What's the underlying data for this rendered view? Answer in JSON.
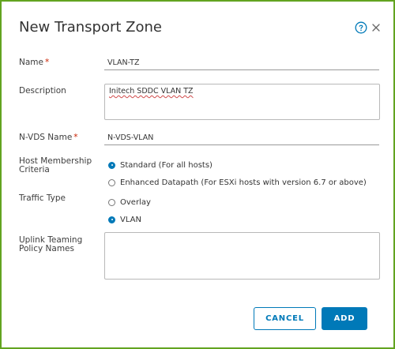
{
  "dialog": {
    "title": "New Transport Zone",
    "icons": {
      "help": "help-circle-icon",
      "close": "close-icon"
    }
  },
  "form": {
    "name": {
      "label": "Name",
      "required_marker": "*",
      "value": "VLAN-TZ"
    },
    "description": {
      "label": "Description",
      "value": "Initech SDDC VLAN TZ"
    },
    "nvds_name": {
      "label": "N-VDS Name",
      "required_marker": "*",
      "value": "N-VDS-VLAN"
    },
    "host_membership": {
      "label_line1": "Host Membership",
      "label_line2": "Criteria",
      "options": [
        {
          "label": "Standard (For all hosts)",
          "selected": true
        },
        {
          "label": "Enhanced Datapath (For ESXi hosts with version 6.7 or above)",
          "selected": false
        }
      ]
    },
    "traffic_type": {
      "label": "Traffic Type",
      "options": [
        {
          "label": "Overlay",
          "selected": false
        },
        {
          "label": "VLAN",
          "selected": true
        }
      ]
    },
    "uplink_teaming": {
      "label_line1": "Uplink Teaming",
      "label_line2": "Policy Names",
      "value": ""
    }
  },
  "actions": {
    "cancel_label": "CANCEL",
    "add_label": "ADD"
  },
  "colors": {
    "accent": "#0079b8",
    "required": "#c92100",
    "frame": "#62a420"
  }
}
